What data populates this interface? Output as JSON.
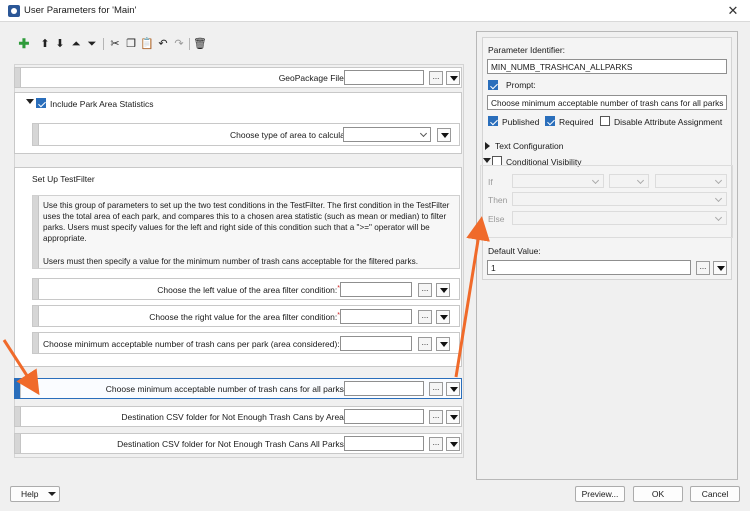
{
  "window": {
    "title": "User Parameters for 'Main'"
  },
  "icons": [
    "add-icon",
    "move-up-icon",
    "move-down-icon",
    "move-top-icon",
    "move-bottom-icon",
    "cut-icon",
    "copy-icon",
    "paste-icon",
    "undo-icon",
    "redo-icon",
    "delete-icon"
  ],
  "params": {
    "geopackage": "GeoPackage File:",
    "park_area_group": "Include Park Area Statistics",
    "area_type": "Choose type of area to calculate:",
    "testfilter_group": "Set Up TestFilter",
    "desc1": "Use this group of parameters to set up the two test conditions in the TestFilter. The first condition in the TestFilter uses the total area of each park, and compares this to a chosen area statistic (such as mean or median) to filter parks. Users must specify values for the left and right side of this condition such that a \">=\" operator will be appropriate.",
    "desc2": "Users must then specify a value for the minimum number of trash cans acceptable for the filtered parks.",
    "left_value": "Choose the left value of the area filter condition:",
    "right_value": "Choose the right value for the area filter condition:",
    "min_per_park": "Choose minimum acceptable number of trash cans per park (area considered):",
    "min_all": "Choose minimum acceptable number of trash cans for all parks:",
    "csv_by_area": "Destination CSV folder for Not Enough Trash Cans by Area:",
    "csv_all": "Destination CSV folder for Not Enough Trash Cans All Parks:"
  },
  "right": {
    "identifier_label": "Parameter Identifier:",
    "identifier_value": "MIN_NUMB_TRASHCAN_ALLPARKS",
    "prompt_label": "Prompt:",
    "prompt_value": "Choose minimum acceptable number of trash cans for all parks",
    "published": "Published",
    "required": "Required",
    "disable_attr": "Disable Attribute Assignment",
    "text_config": "Text Configuration",
    "cond_vis": "Conditional Visibility",
    "if": "If",
    "then": "Then",
    "else": "Else",
    "default_label": "Default Value:",
    "default_value": "1"
  },
  "buttons": {
    "help": "Help",
    "preview": "Preview...",
    "ok": "OK",
    "cancel": "Cancel",
    "ellipsis": "..."
  },
  "colors": {
    "accent": "#2a6ebb",
    "arrow": "#f06a2a",
    "required": "#d02020"
  }
}
